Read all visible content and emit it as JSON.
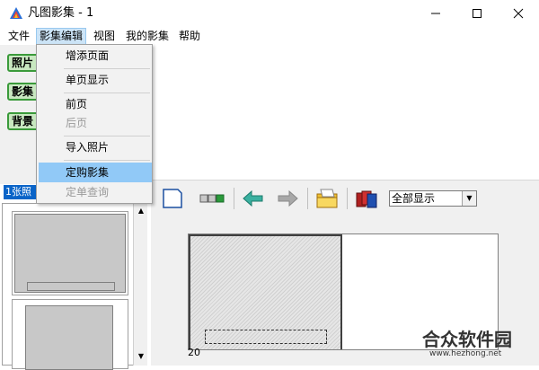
{
  "window": {
    "title": "凡图影集 - 1",
    "min_icon": "minimize-icon",
    "max_icon": "maximize-icon",
    "close_icon": "close-icon"
  },
  "menubar": {
    "items": [
      "文件",
      "影集编辑",
      "视图",
      "我的影集",
      "帮助"
    ],
    "active": "影集编辑"
  },
  "side_buttons": [
    "照片",
    "影集",
    "背景"
  ],
  "dropdown": {
    "items": [
      {
        "label": "增添页面",
        "enabled": true
      },
      {
        "label": "单页显示",
        "enabled": true
      },
      {
        "label": "前页",
        "enabled": true
      },
      {
        "label": "后页",
        "enabled": false
      },
      {
        "label": "导入照片",
        "enabled": true
      },
      {
        "label": "定购影集",
        "enabled": true,
        "highlighted": true
      },
      {
        "label": "定单查询",
        "enabled": false
      }
    ]
  },
  "thumb_panel": {
    "counter": "1张照"
  },
  "toolbar": {
    "icons": [
      "blank-page-icon",
      "two-page-view-icon",
      "back-arrow-icon",
      "forward-arrow-icon",
      "open-folder-icon",
      "album-books-icon"
    ],
    "display_select": "全部显示"
  },
  "page_view": {
    "page_number": "20"
  },
  "watermark": {
    "text": "合众软件园",
    "url": "www.hezhong.net"
  },
  "colors": {
    "accent_green": "#3a9a3a",
    "menu_highlight": "#91c9f7",
    "counter_blue": "#0a64c8"
  }
}
